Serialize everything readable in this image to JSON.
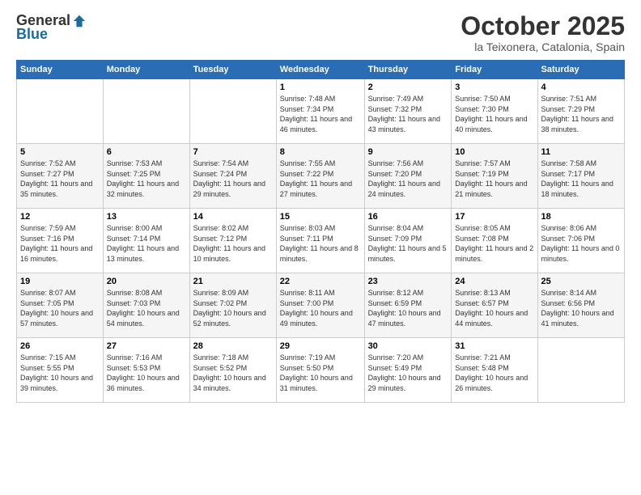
{
  "header": {
    "logo_general": "General",
    "logo_blue": "Blue",
    "month_title": "October 2025",
    "location": "la Teixonera, Catalonia, Spain"
  },
  "days_of_week": [
    "Sunday",
    "Monday",
    "Tuesday",
    "Wednesday",
    "Thursday",
    "Friday",
    "Saturday"
  ],
  "weeks": [
    [
      {
        "num": "",
        "info": ""
      },
      {
        "num": "",
        "info": ""
      },
      {
        "num": "",
        "info": ""
      },
      {
        "num": "1",
        "info": "Sunrise: 7:48 AM\nSunset: 7:34 PM\nDaylight: 11 hours and 46 minutes."
      },
      {
        "num": "2",
        "info": "Sunrise: 7:49 AM\nSunset: 7:32 PM\nDaylight: 11 hours and 43 minutes."
      },
      {
        "num": "3",
        "info": "Sunrise: 7:50 AM\nSunset: 7:30 PM\nDaylight: 11 hours and 40 minutes."
      },
      {
        "num": "4",
        "info": "Sunrise: 7:51 AM\nSunset: 7:29 PM\nDaylight: 11 hours and 38 minutes."
      }
    ],
    [
      {
        "num": "5",
        "info": "Sunrise: 7:52 AM\nSunset: 7:27 PM\nDaylight: 11 hours and 35 minutes."
      },
      {
        "num": "6",
        "info": "Sunrise: 7:53 AM\nSunset: 7:25 PM\nDaylight: 11 hours and 32 minutes."
      },
      {
        "num": "7",
        "info": "Sunrise: 7:54 AM\nSunset: 7:24 PM\nDaylight: 11 hours and 29 minutes."
      },
      {
        "num": "8",
        "info": "Sunrise: 7:55 AM\nSunset: 7:22 PM\nDaylight: 11 hours and 27 minutes."
      },
      {
        "num": "9",
        "info": "Sunrise: 7:56 AM\nSunset: 7:20 PM\nDaylight: 11 hours and 24 minutes."
      },
      {
        "num": "10",
        "info": "Sunrise: 7:57 AM\nSunset: 7:19 PM\nDaylight: 11 hours and 21 minutes."
      },
      {
        "num": "11",
        "info": "Sunrise: 7:58 AM\nSunset: 7:17 PM\nDaylight: 11 hours and 18 minutes."
      }
    ],
    [
      {
        "num": "12",
        "info": "Sunrise: 7:59 AM\nSunset: 7:16 PM\nDaylight: 11 hours and 16 minutes."
      },
      {
        "num": "13",
        "info": "Sunrise: 8:00 AM\nSunset: 7:14 PM\nDaylight: 11 hours and 13 minutes."
      },
      {
        "num": "14",
        "info": "Sunrise: 8:02 AM\nSunset: 7:12 PM\nDaylight: 11 hours and 10 minutes."
      },
      {
        "num": "15",
        "info": "Sunrise: 8:03 AM\nSunset: 7:11 PM\nDaylight: 11 hours and 8 minutes."
      },
      {
        "num": "16",
        "info": "Sunrise: 8:04 AM\nSunset: 7:09 PM\nDaylight: 11 hours and 5 minutes."
      },
      {
        "num": "17",
        "info": "Sunrise: 8:05 AM\nSunset: 7:08 PM\nDaylight: 11 hours and 2 minutes."
      },
      {
        "num": "18",
        "info": "Sunrise: 8:06 AM\nSunset: 7:06 PM\nDaylight: 11 hours and 0 minutes."
      }
    ],
    [
      {
        "num": "19",
        "info": "Sunrise: 8:07 AM\nSunset: 7:05 PM\nDaylight: 10 hours and 57 minutes."
      },
      {
        "num": "20",
        "info": "Sunrise: 8:08 AM\nSunset: 7:03 PM\nDaylight: 10 hours and 54 minutes."
      },
      {
        "num": "21",
        "info": "Sunrise: 8:09 AM\nSunset: 7:02 PM\nDaylight: 10 hours and 52 minutes."
      },
      {
        "num": "22",
        "info": "Sunrise: 8:11 AM\nSunset: 7:00 PM\nDaylight: 10 hours and 49 minutes."
      },
      {
        "num": "23",
        "info": "Sunrise: 8:12 AM\nSunset: 6:59 PM\nDaylight: 10 hours and 47 minutes."
      },
      {
        "num": "24",
        "info": "Sunrise: 8:13 AM\nSunset: 6:57 PM\nDaylight: 10 hours and 44 minutes."
      },
      {
        "num": "25",
        "info": "Sunrise: 8:14 AM\nSunset: 6:56 PM\nDaylight: 10 hours and 41 minutes."
      }
    ],
    [
      {
        "num": "26",
        "info": "Sunrise: 7:15 AM\nSunset: 5:55 PM\nDaylight: 10 hours and 39 minutes."
      },
      {
        "num": "27",
        "info": "Sunrise: 7:16 AM\nSunset: 5:53 PM\nDaylight: 10 hours and 36 minutes."
      },
      {
        "num": "28",
        "info": "Sunrise: 7:18 AM\nSunset: 5:52 PM\nDaylight: 10 hours and 34 minutes."
      },
      {
        "num": "29",
        "info": "Sunrise: 7:19 AM\nSunset: 5:50 PM\nDaylight: 10 hours and 31 minutes."
      },
      {
        "num": "30",
        "info": "Sunrise: 7:20 AM\nSunset: 5:49 PM\nDaylight: 10 hours and 29 minutes."
      },
      {
        "num": "31",
        "info": "Sunrise: 7:21 AM\nSunset: 5:48 PM\nDaylight: 10 hours and 26 minutes."
      },
      {
        "num": "",
        "info": ""
      }
    ]
  ]
}
